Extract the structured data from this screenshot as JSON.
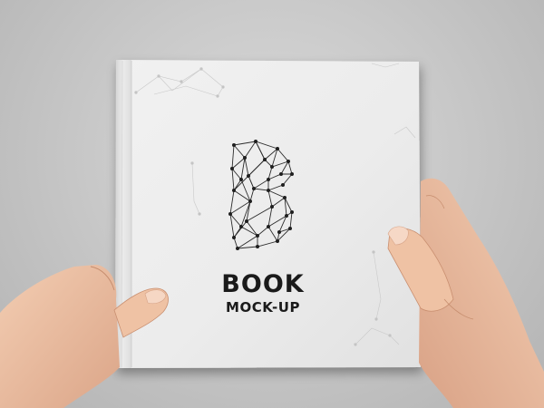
{
  "book": {
    "title": "BOOK",
    "subtitle": "MOCK-UP",
    "monogram": "B"
  },
  "colors": {
    "background": "#c4c4c4",
    "cover": "#ededed",
    "spine": "#dedede",
    "ink": "#1a1a1a",
    "skin": "#efc3a6"
  }
}
